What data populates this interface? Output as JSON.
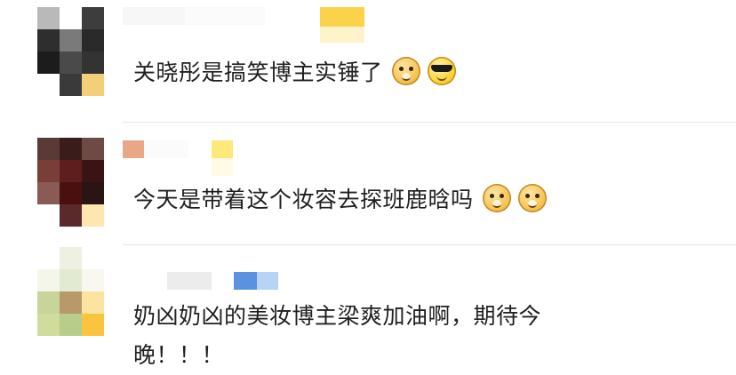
{
  "comments": [
    {
      "text": "关晓彤是搞笑博主实锤了",
      "emojis": [
        "doge-icon",
        "cool-sunglasses-icon"
      ]
    },
    {
      "text": "今天是带着这个妆容去探班鹿晗吗",
      "emojis": [
        "doge-icon",
        "doge-icon"
      ]
    },
    {
      "text_line1": "奶凶奶凶的美妆博主梁爽加油啊，期待今",
      "text_line2": "晚！！！"
    }
  ],
  "colors": {
    "text": "#202020",
    "divider": "#e6e6e6"
  }
}
